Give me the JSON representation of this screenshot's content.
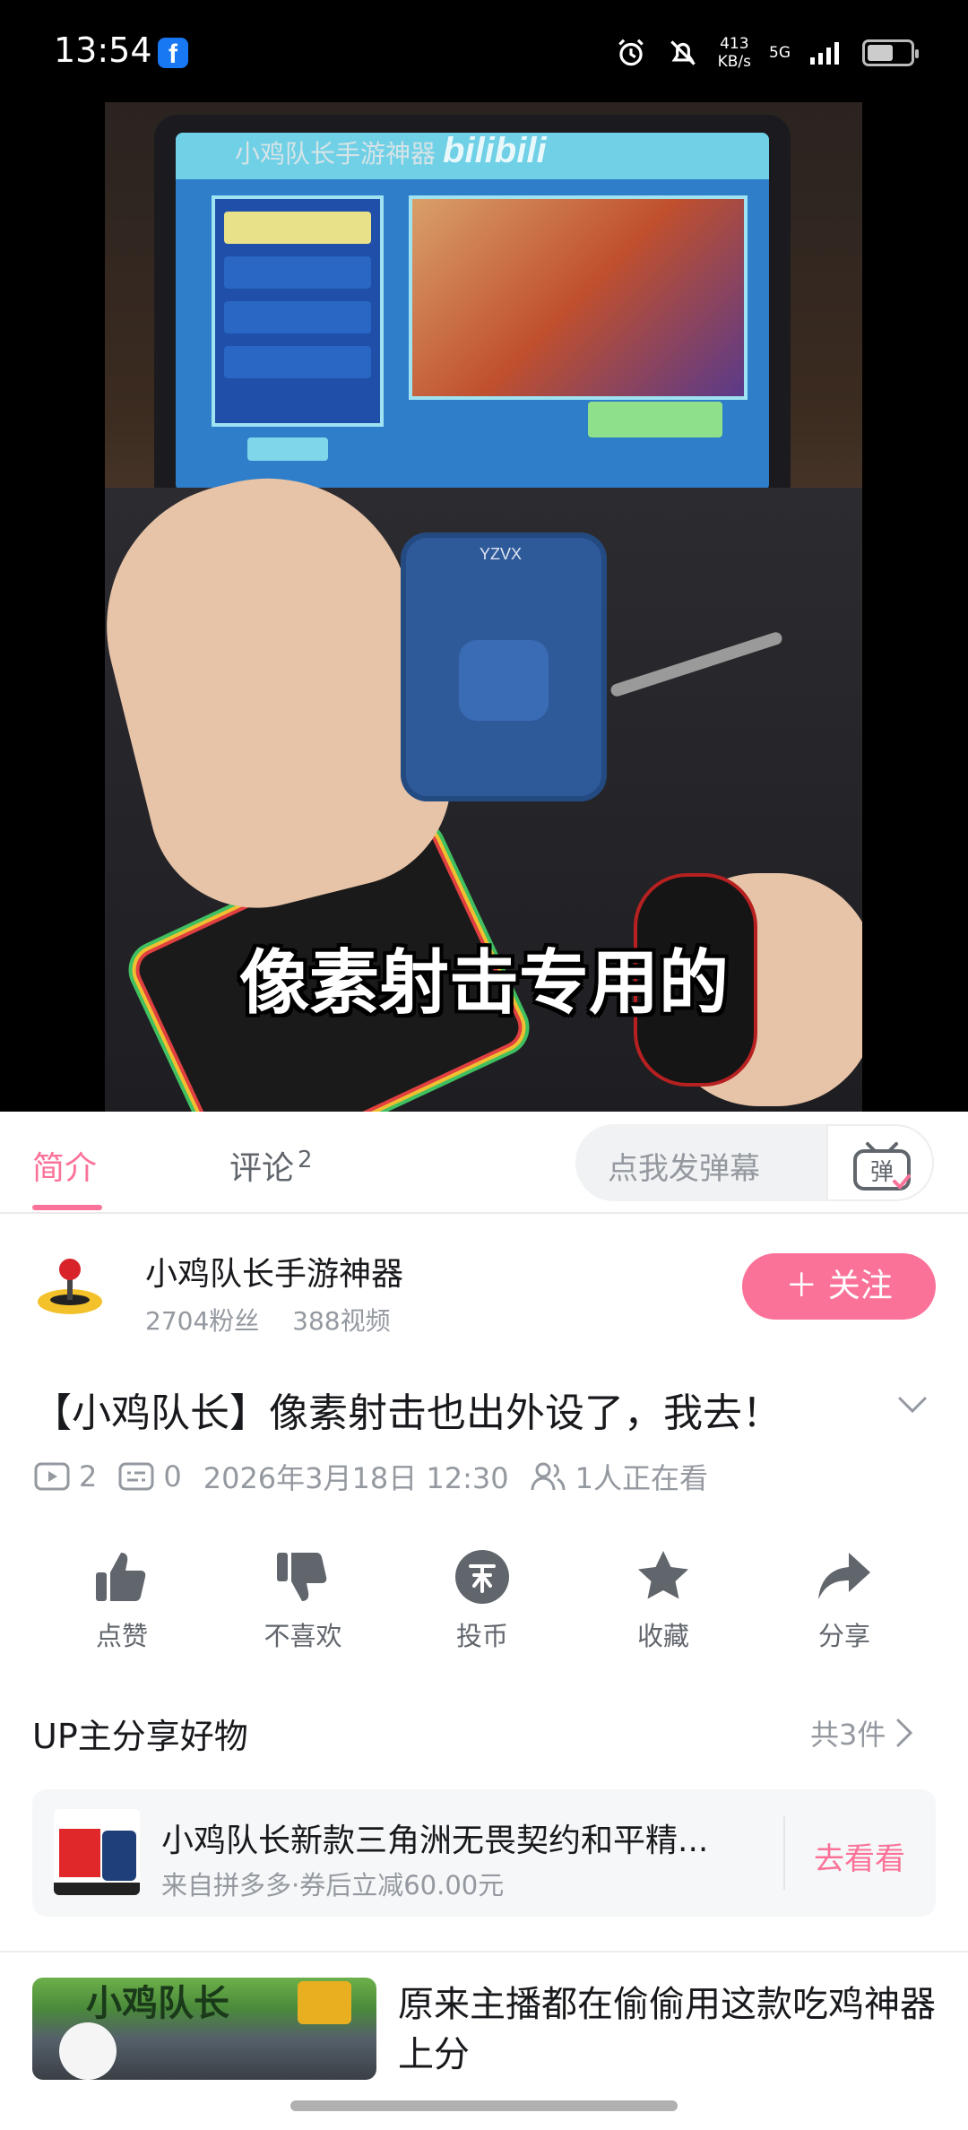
{
  "status_bar": {
    "time": "13:54",
    "app_icon": "f",
    "net_speed_value": "413",
    "net_speed_unit": "KB/s",
    "network": "5G",
    "icons": [
      "alarm-icon",
      "mute-icon",
      "signal-icon",
      "battery-icon"
    ]
  },
  "video": {
    "watermark": "小鸡队长手游神器",
    "watermark_logo": "bilibili",
    "subtitle": "像素射击专用的",
    "device_logo": "YZVX",
    "progress": 0.02
  },
  "tabs": {
    "intro": "简介",
    "comments": "评论",
    "comments_count": "2",
    "danmaku_placeholder": "点我发弹幕",
    "danmaku_button": "弹"
  },
  "uploader": {
    "name": "小鸡队长手游神器",
    "fans": "2704粉丝",
    "videos": "388视频",
    "follow_label": "＋ 关注"
  },
  "video_info": {
    "title": "【小鸡队长】像素射击也出外设了，我去！",
    "plays": "2",
    "danmaku_count": "0",
    "date": "2026年3月18日 12:30",
    "watching": "1人正在看"
  },
  "actions": {
    "like": "点赞",
    "dislike": "不喜欢",
    "coin": "投币",
    "favorite": "收藏",
    "share": "分享"
  },
  "goods": {
    "section_title": "UP主分享好物",
    "count": "共3件",
    "item_name": "小鸡队长新款三角洲无畏契约和平精...",
    "item_sub": "来自拼多多·券后立减60.00元",
    "go_label": "去看看"
  },
  "recommendation": {
    "thumb_text": "小鸡队长",
    "title": "原来主播都在偷偷用这款吃鸡神器上分"
  },
  "colors": {
    "brand_pink": "#fb7299",
    "text_primary": "#18191c",
    "text_secondary": "#9499a0",
    "icon_gray": "#61666d"
  }
}
